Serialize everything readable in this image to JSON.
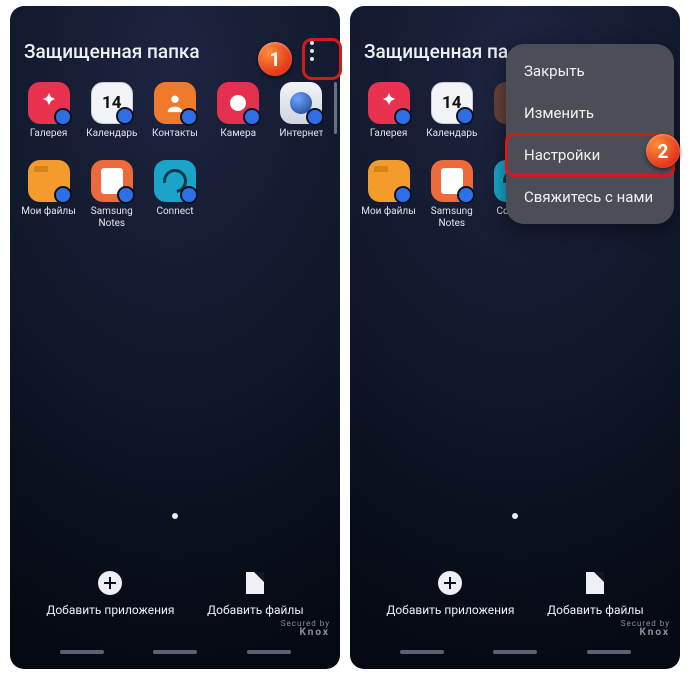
{
  "header": {
    "title": "Защищенная папка",
    "title_truncated": "Защищенная па"
  },
  "apps": [
    {
      "name": "gallery",
      "label": "Галерея"
    },
    {
      "name": "calendar",
      "label": "Календарь",
      "day": "14"
    },
    {
      "name": "contacts",
      "label": "Контакты"
    },
    {
      "name": "camera",
      "label": "Камера"
    },
    {
      "name": "internet",
      "label": "Интернет"
    },
    {
      "name": "files",
      "label": "Мои файлы"
    },
    {
      "name": "notes",
      "label": "Samsung Notes"
    },
    {
      "name": "connect",
      "label": "Connect"
    }
  ],
  "actions": {
    "add_apps": "Добавить приложения",
    "add_files": "Добавить файлы"
  },
  "knox": {
    "line1": "Secured by",
    "line2": "Knox"
  },
  "menu": {
    "close": "Закрыть",
    "edit": "Изменить",
    "settings": "Настройки",
    "contact": "Свяжитесь с нами"
  },
  "callouts": {
    "one": "1",
    "two": "2"
  }
}
